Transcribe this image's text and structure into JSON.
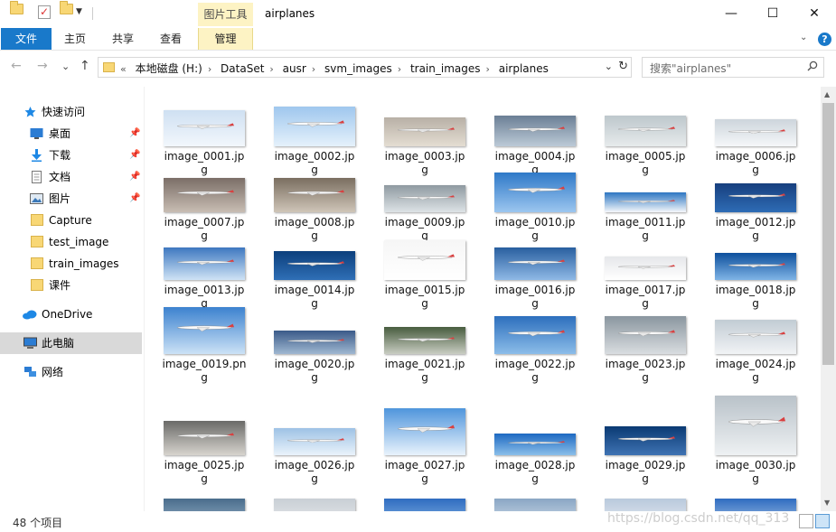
{
  "titlebar": {
    "context_tab_header": "图片工具",
    "title": "airplanes",
    "minimize": "—",
    "maximize": "☐",
    "close": "✕"
  },
  "ribbon": {
    "tabs": [
      "文件",
      "主页",
      "共享",
      "查看",
      "管理"
    ],
    "collapse_glyph": "⌄",
    "help_glyph": "?"
  },
  "nav": {
    "back": "←",
    "forward": "→",
    "recent": "⌄",
    "up": "↑",
    "overflow": "«",
    "breadcrumbs": [
      "本地磁盘 (H:)",
      "DataSet",
      "ausr",
      "svm_images",
      "train_images",
      "airplanes"
    ],
    "separator": "›",
    "dropdown": "⌄",
    "refresh": "↻"
  },
  "search": {
    "placeholder": "搜索\"airplanes\""
  },
  "sidebar": {
    "quick_access": "快速访问",
    "pinned": [
      "桌面",
      "下载",
      "文档",
      "图片"
    ],
    "folders": [
      "Capture",
      "test_image",
      "train_images",
      "课件"
    ],
    "onedrive": "OneDrive",
    "this_pc": "此电脑",
    "network": "网络",
    "pin_glyph": "📌"
  },
  "files": [
    "image_0001.jpg",
    "image_0002.jpg",
    "image_0003.jpg",
    "image_0004.jpg",
    "image_0005.jpg",
    "image_0006.jpg",
    "image_0007.jpg",
    "image_0008.jpg",
    "image_0009.jpg",
    "image_0010.jpg",
    "image_0011.jpg",
    "image_0012.jpg",
    "image_0013.jpg",
    "image_0014.jpg",
    "image_0015.jpg",
    "image_0016.jpg",
    "image_0017.jpg",
    "image_0018.jpg",
    "image_0019.png",
    "image_0020.jpg",
    "image_0021.jpg",
    "image_0022.jpg",
    "image_0023.jpg",
    "image_0024.jpg",
    "image_0025.jpg",
    "image_0026.jpg",
    "image_0027.jpg",
    "image_0028.jpg",
    "image_0029.jpg",
    "image_0030.jpg",
    "",
    "",
    "",
    "",
    "",
    ""
  ],
  "status": {
    "item_count": "48 个项目",
    "watermark": "https://blog.csdn.net/qq_313"
  },
  "colors": {
    "accent": "#1979ca",
    "context_tab": "#fdf3c4",
    "folder": "#f8d775",
    "selected": "#d9d9d9"
  }
}
